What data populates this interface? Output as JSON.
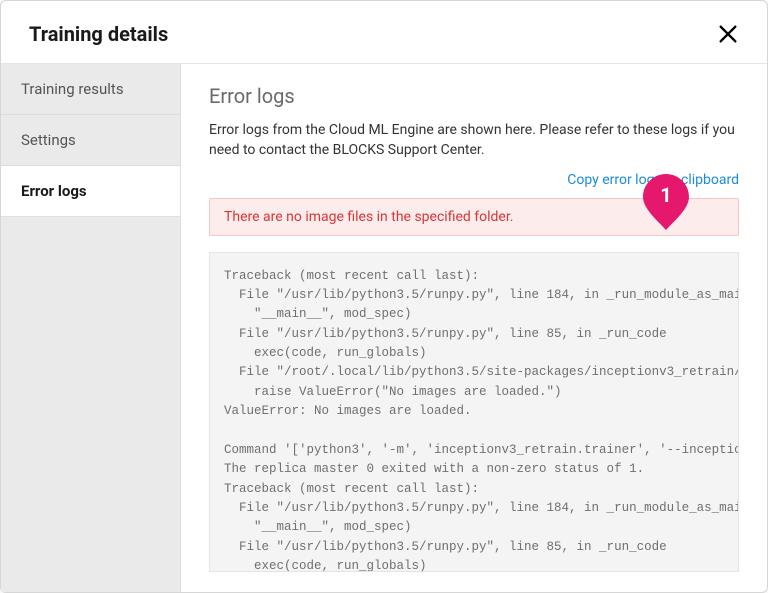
{
  "header": {
    "title": "Training details"
  },
  "sidebar": {
    "tabs": [
      {
        "label": "Training results"
      },
      {
        "label": "Settings"
      },
      {
        "label": "Error logs"
      }
    ],
    "activeIndex": 2
  },
  "main": {
    "heading": "Error logs",
    "description": "Error logs from the Cloud ML Engine are shown here. Please refer to these logs if you need to contact the BLOCKS Support Center.",
    "copy_link": "Copy error logs to clipboard",
    "alert": "There are no image files in the specified folder.",
    "log_text": "Traceback (most recent call last):\n  File \"/usr/lib/python3.5/runpy.py\", line 184, in _run_module_as_main\n    \"__main__\", mod_spec)\n  File \"/usr/lib/python3.5/runpy.py\", line 85, in _run_code\n    exec(code, run_globals)\n  File \"/root/.local/lib/python3.5/site-packages/inceptionv3_retrain/trainer/task.py\"\n    raise ValueError(\"No images are loaded.\")\nValueError: No images are loaded.\n\nCommand '['python3', '-m', 'inceptionv3_retrain.trainer', '--inceptionv3\nThe replica master 0 exited with a non-zero status of 1.\nTraceback (most recent call last):\n  File \"/usr/lib/python3.5/runpy.py\", line 184, in _run_module_as_main\n    \"__main__\", mod_spec)\n  File \"/usr/lib/python3.5/runpy.py\", line 85, in _run_code\n    exec(code, run_globals)\n  File \"/root/.local/lib/python3.5/site-packages/inceptionv3_retrain/trainer/task.py\"\n    raise ValueError(\"No images are loaded.\")\nValueError: No images are loaded.\n\nTo find out more about why your job exited please check the logs: https:"
  },
  "callout": {
    "number": "1"
  }
}
